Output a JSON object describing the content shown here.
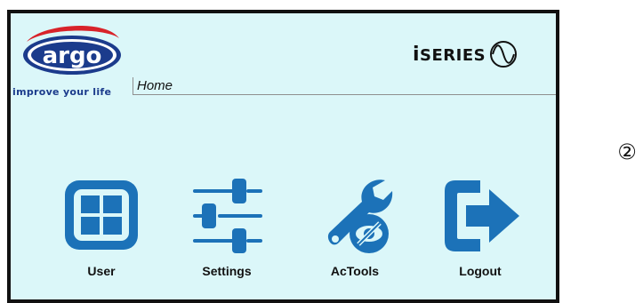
{
  "header": {
    "logo_text": "argo",
    "tagline": "improve your life",
    "brand_prefix": "i",
    "brand_name": "SERIES",
    "breadcrumb": "Home"
  },
  "nav": {
    "items": [
      {
        "label": "User",
        "icon": "grid-icon"
      },
      {
        "label": "Settings",
        "icon": "sliders-icon"
      },
      {
        "label": "AcTools",
        "icon": "wrench-eye-icon"
      },
      {
        "label": "Logout",
        "icon": "logout-arrow-icon"
      }
    ]
  },
  "annotation": {
    "marker": "②"
  },
  "colors": {
    "screen_background": "#dbf7f9",
    "icon_blue": "#1c72b8",
    "logo_blue": "#1b3b8c",
    "logo_red": "#d8232a"
  }
}
